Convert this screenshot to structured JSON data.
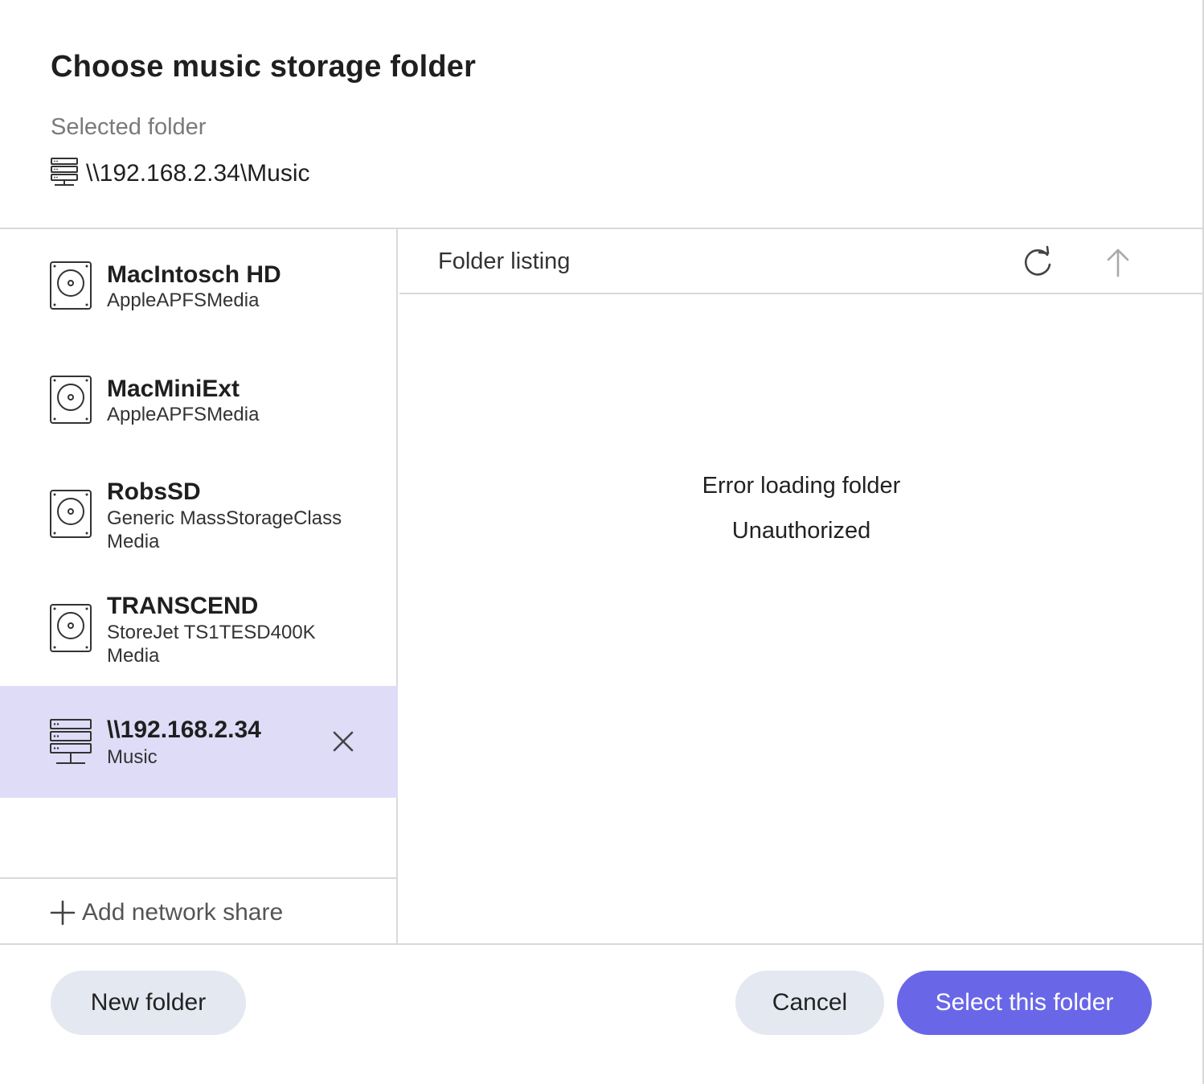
{
  "dialog": {
    "title": "Choose music storage folder",
    "selected_label": "Selected folder",
    "selected_path": "\\\\192.168.2.34\\Music",
    "selected_icon": "network-server-icon"
  },
  "sidebar": {
    "items": [
      {
        "name": "MacIntosch HD",
        "sub": "AppleAPFSMedia",
        "icon": "hard-drive-icon",
        "selected": false
      },
      {
        "name": "MacMiniExt",
        "sub": "AppleAPFSMedia",
        "icon": "hard-drive-icon",
        "selected": false
      },
      {
        "name": "RobsSD",
        "sub": "Generic MassStorageClass Media",
        "icon": "hard-drive-icon",
        "selected": false
      },
      {
        "name": "TRANSCEND",
        "sub": "StoreJet TS1TESD400K Media",
        "icon": "hard-drive-icon",
        "selected": false
      },
      {
        "name": "\\\\192.168.2.34",
        "sub": "Music",
        "icon": "network-server-icon",
        "selected": true
      }
    ],
    "add_share_label": "Add network share"
  },
  "listing": {
    "header_label": "Folder listing",
    "refresh_icon": "refresh-icon",
    "up_icon": "arrow-up-icon",
    "error_title": "Error loading folder",
    "error_detail": "Unauthorized"
  },
  "footer": {
    "new_folder_label": "New folder",
    "cancel_label": "Cancel",
    "select_label": "Select this folder"
  },
  "colors": {
    "accent": "#6967e8",
    "selected_row": "#dedcf7",
    "secondary_button": "#e4e8f0"
  }
}
